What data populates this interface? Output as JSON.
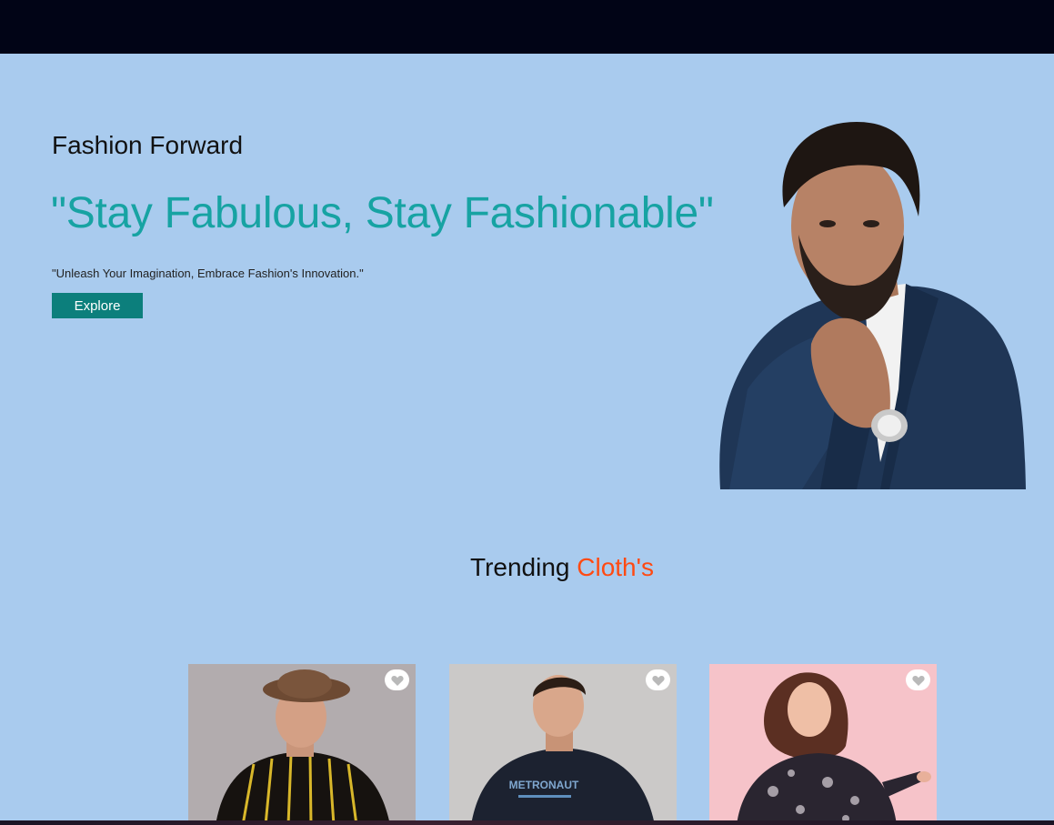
{
  "hero": {
    "kicker": "Fashion Forward",
    "headline": "\"Stay Fabulous, Stay Fashionable\"",
    "tagline": "\"Unleash Your Imagination, Embrace Fashion's Innovation.\"",
    "cta_label": "Explore"
  },
  "trending": {
    "title_part1": "Trending",
    "title_part2": "Cloth's"
  },
  "colors": {
    "topbar": "#010416",
    "background": "#a9cbee",
    "headline": "#17a3a3",
    "button": "#0c7f7c",
    "accent": "#ff4a12"
  },
  "icons": {
    "wishlist": "heart-icon"
  }
}
